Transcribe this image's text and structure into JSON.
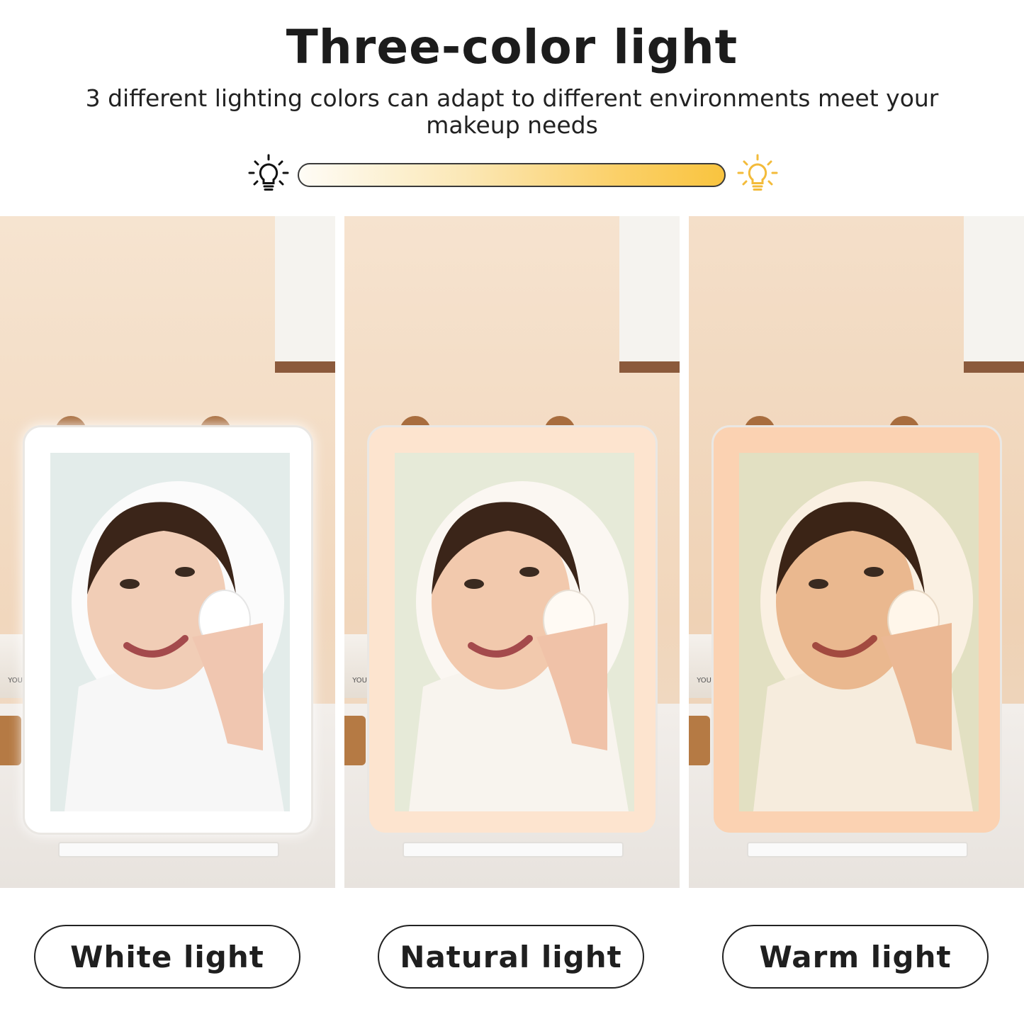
{
  "header": {
    "title": "Three-color light",
    "subtitle": "3 different lighting colors can adapt to different environments meet your makeup needs"
  },
  "indicator": {
    "left_icon": "lightbulb-outline-black-icon",
    "right_icon": "lightbulb-outline-yellow-icon",
    "gradient_from": "#fefcf6",
    "gradient_to": "#f9c43f"
  },
  "panels": [
    {
      "label": "White light",
      "wall": "#f3dcc4",
      "rim": "#ffffff",
      "tint": "rgba(255,255,255,0)"
    },
    {
      "label": "Natural light",
      "wall": "#f3dcc4",
      "rim": "#fde6d2",
      "tint": "rgba(255,225,190,0.10)"
    },
    {
      "label": "Warm light",
      "wall": "#f2d6bc",
      "rim": "#fbd4b4",
      "tint": "rgba(255,190,120,0.22)"
    }
  ],
  "jar_text": "YOU"
}
